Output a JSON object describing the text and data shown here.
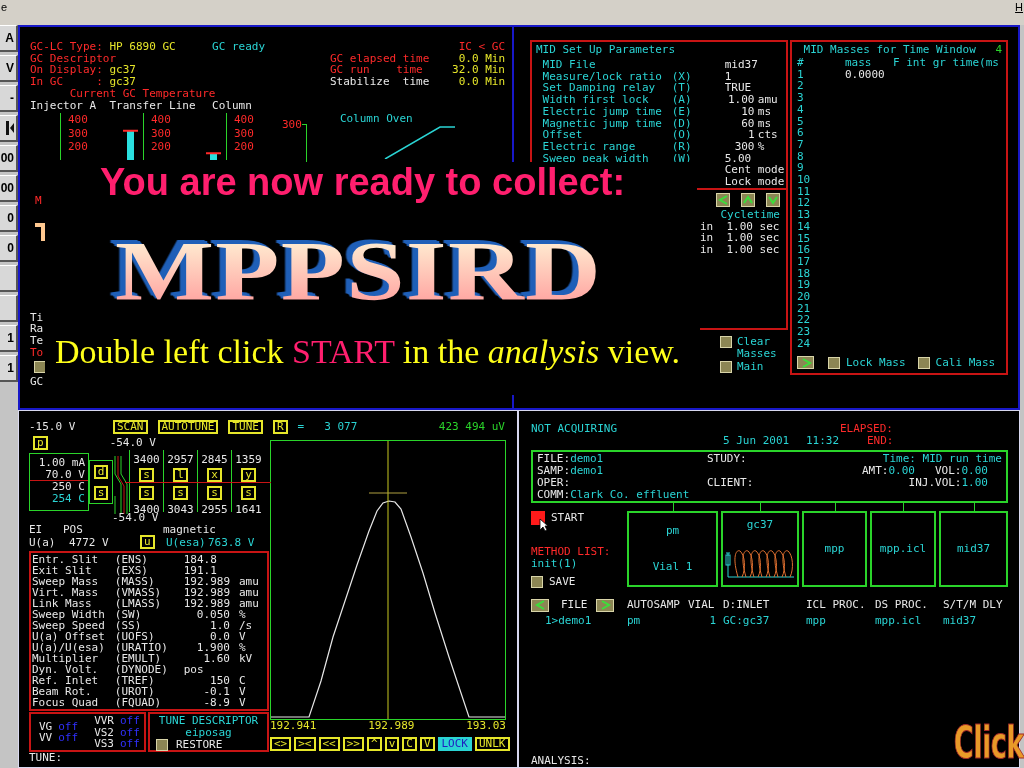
{
  "menu_bar": {
    "left_text": "e",
    "right_text": "H"
  },
  "side_buttons": [
    {
      "kind": "label",
      "label": "A"
    },
    {
      "kind": "label",
      "label": "V"
    },
    {
      "kind": "label",
      "label": "-"
    },
    {
      "kind": "icon"
    },
    {
      "kind": "label",
      "label": "00"
    },
    {
      "kind": "label",
      "label": "00"
    },
    {
      "kind": "label",
      "label": "0"
    },
    {
      "kind": "label",
      "label": "0"
    },
    {
      "kind": "blank"
    },
    {
      "kind": "blank"
    },
    {
      "kind": "label",
      "label": "1"
    },
    {
      "kind": "label",
      "label": "1"
    }
  ],
  "gc": {
    "type_label": "GC-LC Type:",
    "type_value": "HP 6890 GC",
    "status": "GC ready",
    "mode": "IC < GC",
    "descriptor_label": "GC Descriptor",
    "on_display_label": "On Display:",
    "on_display_value": "gc37",
    "in_gc_label": "In GC     :",
    "in_gc_value": "gc37",
    "times": [
      {
        "kind": "status",
        "label": "GC elapsed time",
        "value": "0.0 Min"
      },
      {
        "kind": "status",
        "label": "GC run    time",
        "value": "32.0 Min"
      },
      {
        "kind": "setting",
        "label": "Stabilize  time",
        "value": "0.0 Min"
      }
    ],
    "temperature_title": "Current GC Temperature",
    "gauges": [
      {
        "label": "Injector A",
        "ticks": [
          "400",
          "300",
          "200"
        ]
      },
      {
        "label": "Transfer Line",
        "ticks": [
          "400",
          "300",
          "200"
        ],
        "level": 0.65
      },
      {
        "label": "Column",
        "ticks": [
          "400",
          "300",
          "200"
        ],
        "level": 0.15
      }
    ],
    "oven": {
      "title": "Column Oven",
      "scale_label": "300"
    },
    "marker_label": "M",
    "side_labels": [
      {
        "kind": "normal",
        "text": "Ti"
      },
      {
        "kind": "normal",
        "text": "Ra"
      },
      {
        "kind": "normal",
        "text": "Te"
      },
      {
        "kind": "alert",
        "text": "To"
      }
    ],
    "gc_toggle": {
      "label": "GC",
      "checked": false
    }
  },
  "mid_setup": {
    "title": "MID Set Up Parameters",
    "rows": [
      {
        "kind": "param",
        "label": "MID File",
        "value": "mid37"
      },
      {
        "kind": "param",
        "label": "Measure/lock ratio",
        "code": "(X)",
        "value": "1"
      },
      {
        "kind": "param",
        "label": "Set Damping relay",
        "code": "(T)",
        "value": "TRUE"
      },
      {
        "kind": "param",
        "label": "Width first lock",
        "code": "(A)",
        "value": "1.00",
        "unit": "amu"
      },
      {
        "kind": "param",
        "label": "Electric jump time",
        "code": "(E)",
        "value": "10",
        "unit": "ms"
      },
      {
        "kind": "param",
        "label": "Magnetic jump time",
        "code": "(D)",
        "value": "60",
        "unit": "ms"
      },
      {
        "kind": "param",
        "label": "Offset",
        "code": "(O)",
        "value": "1",
        "unit": "cts"
      },
      {
        "kind": "param",
        "label": "Electric range",
        "code": "(R)",
        "value": "300",
        "unit": "%"
      },
      {
        "kind": "param",
        "label": "Sweep peak width",
        "code": "(W)",
        "value": "5.00"
      },
      {
        "kind": "mode",
        "value": "Cent mode"
      },
      {
        "kind": "mode",
        "value": "Lock mode"
      }
    ],
    "cycletime_label": "Cycletime",
    "cycle_rows": [
      {
        "prefix": "in",
        "value": "1.00 sec"
      },
      {
        "prefix": "in",
        "value": "1.00 sec"
      },
      {
        "prefix": "in",
        "value": "1.00 sec"
      }
    ],
    "options": [
      {
        "label": "Clear Masses",
        "checked": false
      },
      {
        "label": "Main",
        "checked": false
      }
    ]
  },
  "mid_masses": {
    "title": "MID Masses for Time Window",
    "window": "4",
    "columns": [
      "#",
      "mass",
      "F int gr time(ms"
    ],
    "rows": [
      {
        "index": "1",
        "mass": "0.0000"
      },
      {
        "index": "2"
      },
      {
        "index": "3"
      },
      {
        "index": "4"
      },
      {
        "index": "5"
      },
      {
        "index": "6"
      },
      {
        "index": "7"
      },
      {
        "index": "8"
      },
      {
        "index": "9"
      },
      {
        "index": "10"
      },
      {
        "index": "11"
      },
      {
        "index": "12"
      },
      {
        "index": "13"
      },
      {
        "index": "14"
      },
      {
        "index": "15"
      },
      {
        "index": "16"
      },
      {
        "index": "17"
      },
      {
        "index": "18"
      },
      {
        "index": "19"
      },
      {
        "index": "20"
      },
      {
        "index": "21"
      },
      {
        "index": "22"
      },
      {
        "index": "23"
      },
      {
        "index": "24"
      }
    ],
    "options": [
      {
        "label": "Lock Mass",
        "checked": false
      },
      {
        "label": "Cali Mass",
        "checked": false
      }
    ]
  },
  "tune": {
    "source_voltage": "-15.0 V",
    "buttons": [
      "SCAN",
      "AUTOTUNE",
      "TUNE",
      "R"
    ],
    "equals": "=",
    "reading": "3 077",
    "intensity": "423 494 uV",
    "p_button": "p",
    "extraction_top": "-54.0 V",
    "source": [
      {
        "kind": "set",
        "value": "1.00 mA"
      },
      {
        "kind": "set",
        "value": "70.0 V"
      },
      {
        "kind": "set",
        "value": "250 C"
      },
      {
        "kind": "actual",
        "value": "254 C"
      }
    ],
    "source_buttons": [
      "d",
      "s"
    ],
    "lens_top_values": [
      "3400",
      "2957",
      "2845",
      "1359"
    ],
    "lens_top_buttons": [
      "s",
      "l",
      "x",
      "y"
    ],
    "lens_bottom_buttons": [
      "s",
      "s",
      "s",
      "s"
    ],
    "lens_bottom_values": [
      "3400",
      "3043",
      "2955",
      "1641"
    ],
    "extraction_bottom": "-54.0 V",
    "ion_mode": "EI",
    "polarity": "POS",
    "field": "magnetic",
    "ua_label": "U(a)",
    "ua_value": "4772 V",
    "u_button": "u",
    "uesa_label": "U(esa)",
    "uesa_value": "763.8 V",
    "params": [
      {
        "label": "Entr. Slit",
        "code": "(ENS)",
        "value": "184.8"
      },
      {
        "label": "Exit Slit",
        "code": "(EXS)",
        "value": "191.1"
      },
      {
        "label": "Sweep Mass",
        "code": "(MASS)",
        "value": "192.989",
        "unit": "amu"
      },
      {
        "label": "Virt. Mass",
        "code": "(VMASS)",
        "value": "192.989",
        "unit": "amu"
      },
      {
        "label": "Link Mass",
        "code": "(LMASS)",
        "value": "192.989",
        "unit": "amu"
      },
      {
        "label": "Sweep Width",
        "code": "(SW)",
        "value": "0.050",
        "unit": "%"
      },
      {
        "label": "Sweep Speed",
        "code": "(SS)",
        "value": "1.0",
        "unit": "/s"
      },
      {
        "label": "U(a) Offset",
        "code": "(UOFS)",
        "value": "0.0",
        "unit": "V"
      },
      {
        "label": "U(a)/U(esa)",
        "code": "(URATIO)",
        "value": "1.900",
        "unit": "%"
      },
      {
        "label": "Multiplier",
        "code": "(EMULT)",
        "value": "1.60",
        "unit": "kV"
      },
      {
        "label": "Dyn. Volt.",
        "code": "(DYNODE)",
        "value": "pos"
      },
      {
        "label": "Ref. Inlet",
        "code": "(TREF)",
        "value": "150",
        "unit": "C"
      },
      {
        "label": "Beam Rot.",
        "code": "(UROT)",
        "value": "-0.1",
        "unit": "V"
      },
      {
        "label": "Focus Quad",
        "code": "(FQUAD)",
        "value": "-8.9",
        "unit": "V"
      }
    ],
    "gauge_valves": [
      {
        "label": "VG",
        "value": "off"
      },
      {
        "label": "VV",
        "value": "off"
      }
    ],
    "valves": [
      {
        "label": "VVR",
        "value": "off"
      },
      {
        "label": "VS2",
        "value": "off"
      },
      {
        "label": "VS3",
        "value": "off"
      }
    ],
    "descriptor": {
      "title": "TUNE DESCRIPTOR",
      "name": "eiposag",
      "restore": {
        "label": "RESTORE",
        "checked": false
      }
    },
    "plot": {
      "x_labels": [
        "192.941",
        "192.989",
        "193.03"
      ],
      "controls": [
        {
          "label": "<>",
          "selected": false
        },
        {
          "label": "><",
          "selected": false
        },
        {
          "label": "<<",
          "selected": false
        },
        {
          "label": ">>",
          "selected": false
        },
        {
          "label": "^",
          "selected": false
        },
        {
          "label": "v",
          "selected": false
        },
        {
          "label": "C",
          "selected": false
        },
        {
          "label": "V",
          "selected": false
        },
        {
          "label": "LOCK",
          "selected": true
        },
        {
          "label": "UNLK",
          "selected": false
        }
      ]
    },
    "footer": "TUNE:"
  },
  "acquisition": {
    "status": "NOT ACQUIRING",
    "elapsed_label": "ELAPSED:",
    "date": "5 Jun 2001",
    "time": "11:32",
    "end_label": "END:",
    "info": {
      "file": {
        "label": "FILE:",
        "value": "demo1"
      },
      "study_label": "STUDY:",
      "time_mode": "Time: MID run time",
      "sample": {
        "label": "SAMP:",
        "value": "demo1"
      },
      "amount": {
        "label": "AMT:",
        "value": "0.00"
      },
      "volume": {
        "label": "VOL:",
        "value": "0.00"
      },
      "operator_label": "OPER:",
      "client_label": "CLIENT:",
      "injection_volume": {
        "label": "INJ.VOL:",
        "value": "1.00"
      },
      "comment": {
        "label": "COMM:",
        "value": "Clark Co. effluent"
      }
    },
    "start_label": "START",
    "method_list_label": "METHOD LIST:",
    "method_list": "init(1)",
    "save": {
      "label": "SAVE",
      "checked": false
    },
    "methods": [
      {
        "kind": "autosampler",
        "title": "pm",
        "detail": "Vial 1"
      },
      {
        "kind": "gc",
        "title": "gc37"
      },
      {
        "kind": "plain",
        "title": "mpp"
      },
      {
        "kind": "plain",
        "title": "mpp.icl"
      },
      {
        "kind": "plain",
        "title": "mid37"
      }
    ],
    "columns": [
      "FILE",
      "AUTOSAMP",
      "VIAL",
      "D:INLET",
      "ICL PROC.",
      "DS PROC.",
      "S/T/M DLY"
    ],
    "rows": [
      [
        "1>demo1",
        "pm",
        "1",
        "GC:gc37",
        "mpp",
        "mpp.icl",
        "mid37"
      ]
    ],
    "footer": "ANALYSIS:"
  },
  "overlay": {
    "headline": "You are now ready to collect:",
    "logo": "MPPSIRD",
    "instruction": "Double left click **START** in the *analysis* view.",
    "corner_label": "Click"
  }
}
